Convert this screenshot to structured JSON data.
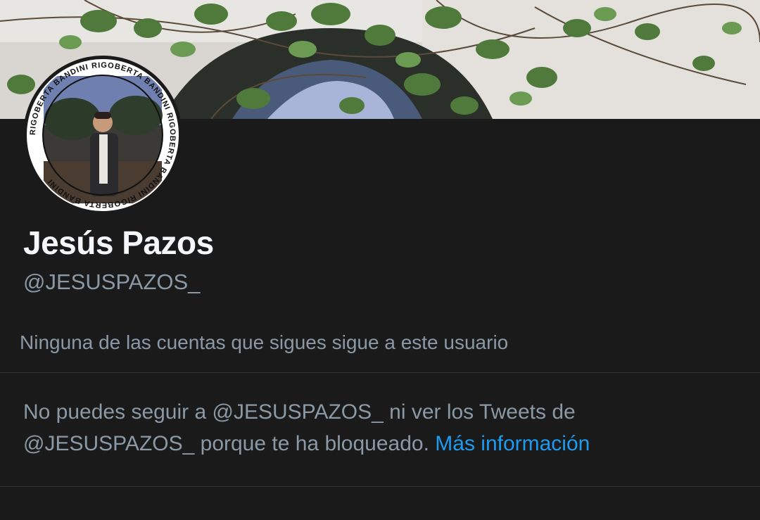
{
  "profile": {
    "display_name": "Jesús Pazos",
    "handle": "@JESUSPAZOS_",
    "follow_context": "Ninguna de las cuentas que sigues sigue a este usuario",
    "avatar_ring_text": "RIGOBERTA BANDINI RIGOBERTA BANDINI RIGOBERTA BANDINI RIGOBERTA BANDINI"
  },
  "blocked_notice": {
    "line1": "No puedes seguir a @JESUSPAZOS_ ni ver los Tweets de",
    "line2": "@JESUSPAZOS_ porque te ha bloqueado.",
    "learn_more_label": "Más información"
  },
  "colors": {
    "background": "#1a1a1b",
    "primary_text": "#f5f8fa",
    "secondary_text": "#8b98a5",
    "link": "#1d9bf0",
    "divider": "#2f3336"
  }
}
